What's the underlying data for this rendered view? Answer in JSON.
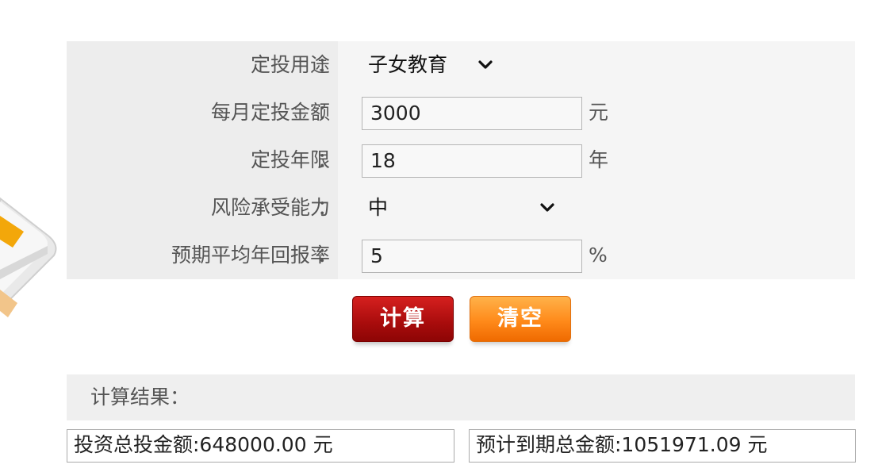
{
  "form": {
    "rows": [
      {
        "label": "定投用途",
        "colon": "：",
        "value": "子女教育"
      },
      {
        "label": "每月定投金额",
        "colon": "：",
        "value": "3000",
        "unit": "元"
      },
      {
        "label": "定投年限",
        "colon": "：",
        "value": "18",
        "unit": "年"
      },
      {
        "label": "风险承受能力",
        "colon": "：",
        "value": "中"
      },
      {
        "label": "预期平均年回报率",
        "colon": "：",
        "value": "5",
        "unit": "%"
      }
    ]
  },
  "buttons": {
    "calculate": "计算",
    "clear": "清空"
  },
  "result": {
    "title": "计算结果：",
    "total_invested": "投资总投金额:648000.00 元",
    "expected_total": "预计到期总金额:1051971.09 元"
  },
  "icons": {
    "dropdown": "chevron-down-icon",
    "decoration": "calculator-icon"
  }
}
